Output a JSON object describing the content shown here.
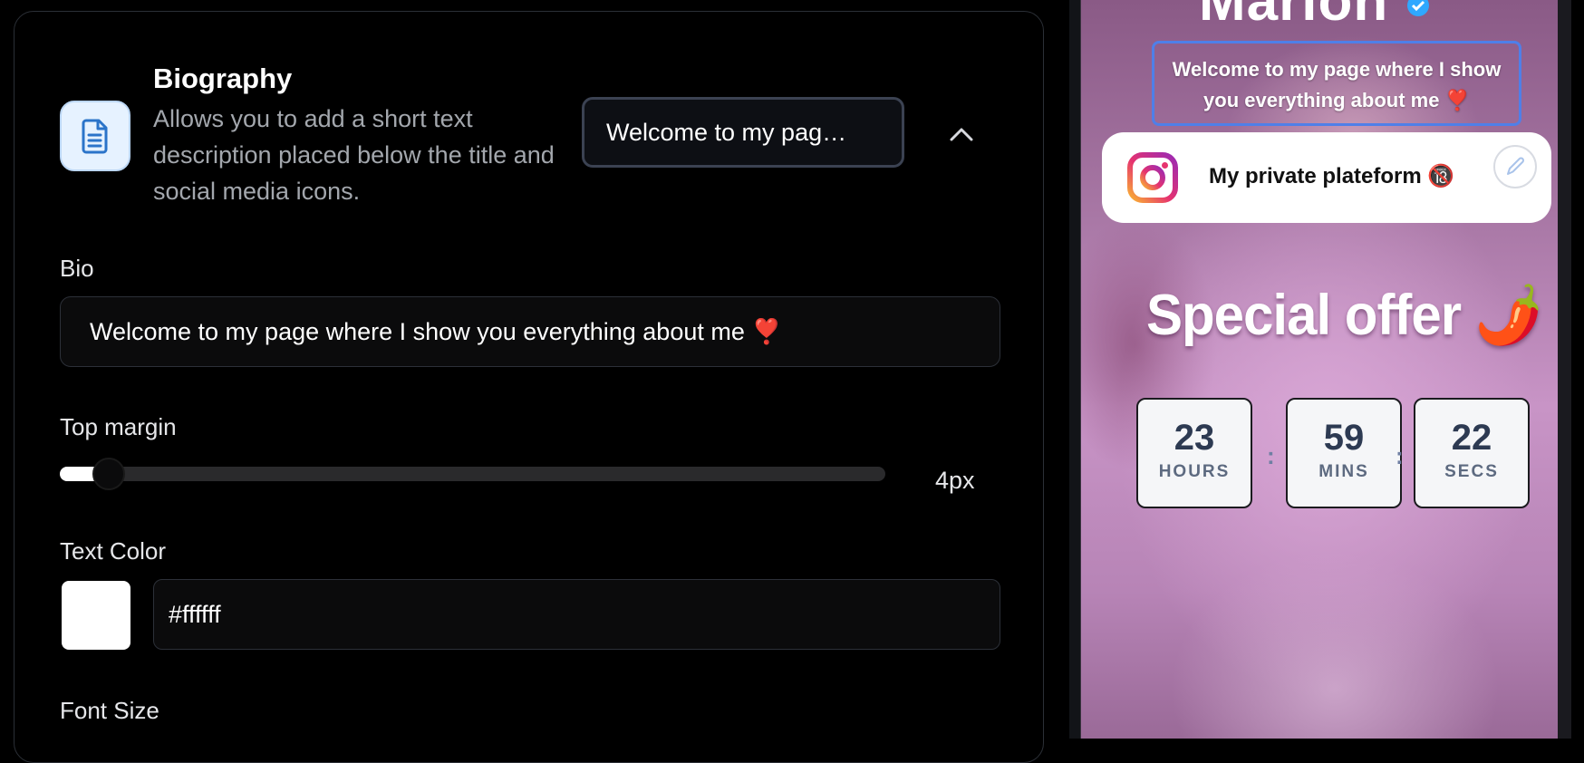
{
  "editor": {
    "section": {
      "title": "Biography",
      "description": "Allows you to add a short text description placed below the title and social media icons.",
      "preview_value": "Welcome to my pag…",
      "icon": "document-icon",
      "collapse_icon": "chevron-up-icon"
    },
    "bio": {
      "label": "Bio",
      "value": "Welcome to my page where I show you everything about me ❣️"
    },
    "top_margin": {
      "label": "Top margin",
      "value_label": "4px",
      "level": 0.04
    },
    "text_color": {
      "label": "Text Color",
      "swatch_color": "#ffffff",
      "value": "#ffffff"
    },
    "font_size": {
      "label": "Font Size"
    }
  },
  "preview": {
    "profile_name": "Marion",
    "bio_text": "Welcome to my page where I show you everything about me ❣️",
    "bio_border_color": "#4f7fe8",
    "link": {
      "title": "My private plateform 🔞",
      "icon": "instagram-icon",
      "edit_icon": "pencil-icon"
    },
    "offer_title": "Special offer 🌶️",
    "countdown": [
      {
        "value": "23",
        "unit": "HOURS"
      },
      {
        "value": "59",
        "unit": "MINS"
      },
      {
        "value": "22",
        "unit": "SECS"
      }
    ],
    "separator": ":"
  }
}
